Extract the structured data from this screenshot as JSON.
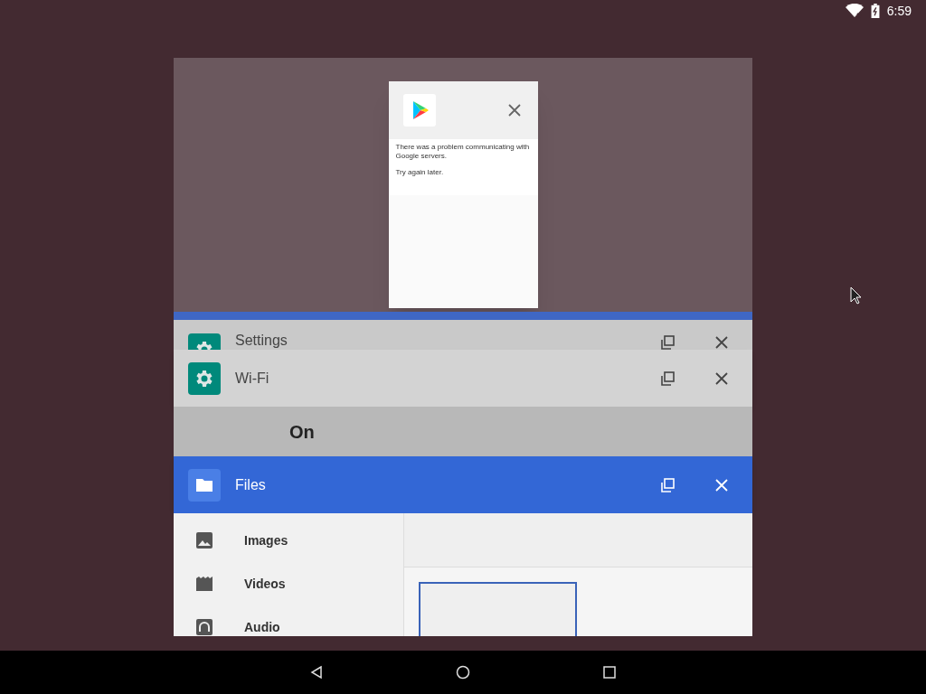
{
  "status_bar": {
    "time": "6:59"
  },
  "dialog_card": {
    "message": "There was a problem communicating with Google servers.",
    "hint": "Try again later."
  },
  "windows": [
    {
      "kind": "settings",
      "title": "Settings"
    },
    {
      "kind": "settings",
      "title": "Wi-Fi",
      "body": "On"
    },
    {
      "kind": "files",
      "title": "Files",
      "roots": [
        {
          "kind": "images",
          "label": "Images"
        },
        {
          "kind": "videos",
          "label": "Videos"
        },
        {
          "kind": "audio",
          "label": "Audio"
        }
      ]
    }
  ]
}
